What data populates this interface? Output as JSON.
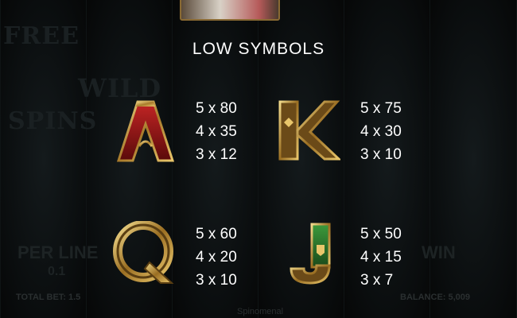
{
  "title": "LOW SYMBOLS",
  "colors": {
    "gold": "#c9a34a",
    "red_fill": "#9a1c1c",
    "green_fill": "#2f7a2f",
    "text": "#ffffff",
    "background": "#050506"
  },
  "symbols": [
    {
      "id": "A",
      "letter": "A",
      "icon": "letter-a-symbol-icon",
      "payouts": [
        "5 x 80",
        "4 x 35",
        "3 x 12"
      ]
    },
    {
      "id": "K",
      "letter": "K",
      "icon": "letter-k-symbol-icon",
      "payouts": [
        "5 x 75",
        "4 x 30",
        "3 x 10"
      ]
    },
    {
      "id": "Q",
      "letter": "Q",
      "icon": "letter-q-symbol-icon",
      "payouts": [
        "5 x 60",
        "4 x 20",
        "3 x 10"
      ]
    },
    {
      "id": "J",
      "letter": "J",
      "icon": "letter-j-symbol-icon",
      "payouts": [
        "5 x 50",
        "4 x 15",
        "3 x 7"
      ]
    }
  ],
  "background_hud": {
    "total_bet": "TOTAL BET: 1.5",
    "balance": "BALANCE: 5,009",
    "per_line_label": "PER LINE",
    "per_line_value": "0.1",
    "win_label": "WIN",
    "free_spins_text": "FREE",
    "spins_text": "SPINS",
    "wild_text": "WILD",
    "brand": "Spinomenal"
  }
}
